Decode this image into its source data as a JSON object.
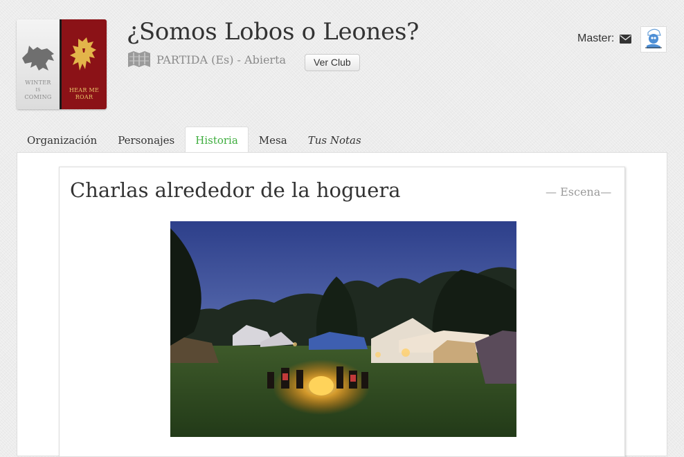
{
  "header": {
    "title": "¿Somos Lobos o Leones?",
    "subtitle": "PARTIDA (Es) - Abierta",
    "ver_club": "Ver Club",
    "master_label": "Master:"
  },
  "logo": {
    "stark_motto": "WINTER\nIS\nCOMING",
    "lannister_motto": "HEAR ME\nROAR",
    "stark_color": "#e6e6e6",
    "lannister_color": "#8b1217"
  },
  "tabs": [
    {
      "label": "Organización",
      "active": false
    },
    {
      "label": "Personajes",
      "active": false
    },
    {
      "label": "Historia",
      "active": true
    },
    {
      "label": "Mesa",
      "active": false
    },
    {
      "label": "Tus Notas",
      "active": false
    }
  ],
  "scene": {
    "title": "Charlas alrededor de la hoguera",
    "tag": "— Escena—"
  },
  "colors": {
    "active_tab": "#3dad3d",
    "text": "#333333",
    "muted": "#8a8a8a"
  },
  "icons": {
    "map": "map-icon",
    "mail": "envelope-icon",
    "avatar": "smurf-avatar"
  }
}
